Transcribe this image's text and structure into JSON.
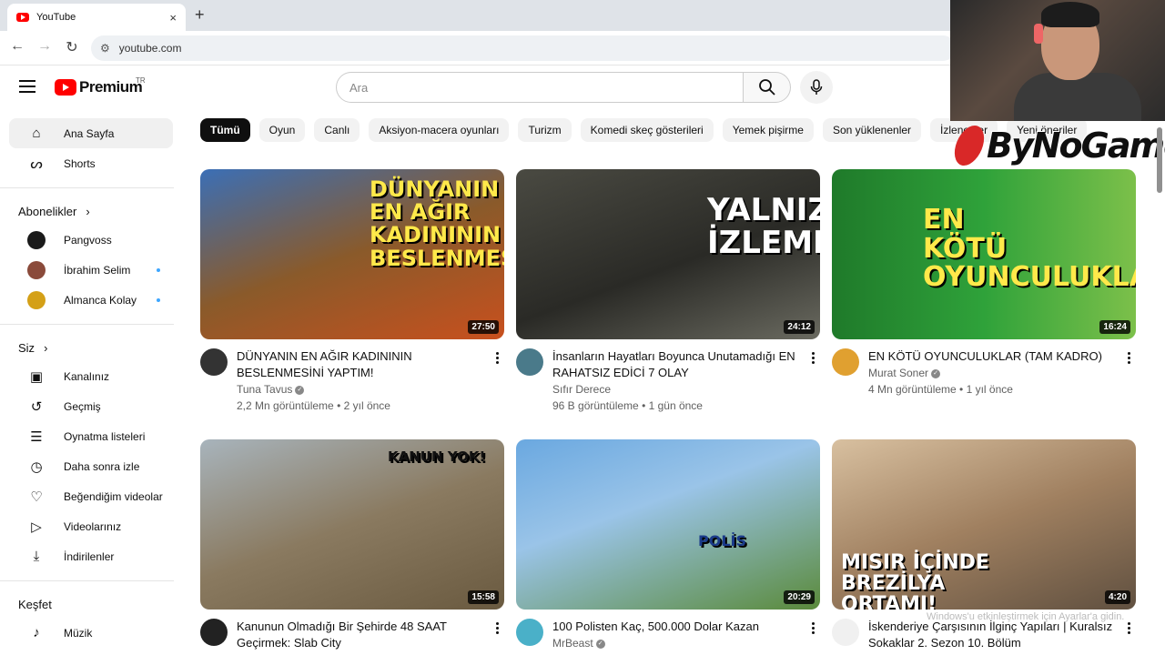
{
  "browser": {
    "tab_title": "YouTube",
    "tab_close": "×",
    "new_tab": "+",
    "url": "youtube.com"
  },
  "header": {
    "logo_text": "Premium",
    "region": "TR",
    "search_placeholder": "Ara"
  },
  "sidebar": {
    "main": [
      {
        "label": "Ana Sayfa",
        "icon": "home-icon"
      },
      {
        "label": "Shorts",
        "icon": "shorts-icon"
      }
    ],
    "subscriptions_title": "Abonelikler",
    "subscriptions": [
      {
        "label": "Pangvoss",
        "color": "#1a1a1a",
        "new": false
      },
      {
        "label": "İbrahim Selim",
        "color": "#8a4a3a",
        "new": true
      },
      {
        "label": "Almanca Kolay",
        "color": "#d4a017",
        "new": true
      }
    ],
    "you_title": "Siz",
    "you": [
      {
        "label": "Kanalınız",
        "icon": "channel-icon"
      },
      {
        "label": "Geçmiş",
        "icon": "history-icon"
      },
      {
        "label": "Oynatma listeleri",
        "icon": "playlists-icon"
      },
      {
        "label": "Daha sonra izle",
        "icon": "watch-later-icon"
      },
      {
        "label": "Beğendiğim videolar",
        "icon": "like-icon"
      },
      {
        "label": "Videolarınız",
        "icon": "your-videos-icon"
      },
      {
        "label": "İndirilenler",
        "icon": "download-icon"
      }
    ],
    "explore_title": "Keşfet",
    "explore": [
      {
        "label": "Müzik",
        "icon": "music-icon"
      }
    ]
  },
  "chips": [
    "Tümü",
    "Oyun",
    "Canlı",
    "Aksiyon-macera oyunları",
    "Turizm",
    "Komedi skeç gösterileri",
    "Yemek pişirme",
    "Son yüklenenler",
    "İzlenenler",
    "Yeni öneriler"
  ],
  "videos": [
    {
      "title": "DÜNYANIN EN AĞIR KADINININ BESLENMESİNİ YAPTIM!",
      "channel": "Tuna Tavus",
      "verified": true,
      "stats": "2,2 Mn görüntüleme • 2 yıl önce",
      "duration": "27:50",
      "thumb_text": "DÜNYANIN EN AĞIR KADINININ BESLENMESİ",
      "thumb_bg": "linear-gradient(160deg,#3b6fb6 0%,#8a5a2a 50%,#c8501e 100%)",
      "avatar_color": "#333"
    },
    {
      "title": "İnsanların Hayatları Boyunca Unutamadığı EN RAHATSIZ EDİCİ 7 OLAY",
      "channel": "Sıfır Derece",
      "verified": false,
      "stats": "96 B görüntüleme • 1 gün önce",
      "duration": "24:12",
      "thumb_text": "YALNIZ İZLEME",
      "thumb_bg": "linear-gradient(160deg,#4a4a42 0%,#2a2a26 55%,#6a6a60 100%)",
      "avatar_color": "#4a7a8a"
    },
    {
      "title": "EN KÖTÜ OYUNCULUKLAR (TAM KADRO)",
      "channel": "Murat Soner",
      "verified": true,
      "stats": "4 Mn görüntüleme • 1 yıl önce",
      "duration": "16:24",
      "thumb_text": "EN KÖTÜ OYUNCULUKLAR",
      "thumb_bg": "linear-gradient(90deg,#1f7a2a 0%,#2fa23a 50%,#7cc04a 100%)",
      "avatar_color": "#e0a030"
    },
    {
      "title": "Kanunun Olmadığı Bir Şehirde 48 SAAT Geçirmek: Slab City",
      "channel": "",
      "verified": false,
      "stats": "",
      "duration": "15:58",
      "thumb_text": "KANUN YOK!",
      "thumb_bg": "linear-gradient(160deg,#a8b4bc 0%,#8a7a60 50%,#6a5a40 100%)",
      "avatar_color": "#222"
    },
    {
      "title": "100 Polisten Kaç, 500.000 Dolar Kazan",
      "channel": "MrBeast",
      "verified": true,
      "stats": "",
      "duration": "20:29",
      "thumb_text": "POLİS",
      "thumb_bg": "linear-gradient(160deg,#6aa8e0 0%,#9ac4e8 40%,#5a8a3a 100%)",
      "avatar_color": "#4ab0c8"
    },
    {
      "title": "İskenderiye Çarşısının İlginç Yapıları | Kuralsız Sokaklar 2. Sezon 10. Bölüm",
      "channel": "",
      "verified": false,
      "stats": "",
      "duration": "4:20",
      "thumb_text": "MISIR İÇİNDE BREZİLYA ORTAMI!",
      "thumb_bg": "linear-gradient(160deg,#d8c0a0 0%,#a08060 50%,#605040 100%)",
      "avatar_color": "#f0f0f0"
    }
  ],
  "overlay": {
    "brand": "ByNoGame",
    "watermark_line1": "Windows'u etkinleştirmek için Ayarlar'a gidin.",
    "watermark_line2": ""
  },
  "colors": {
    "accent": "#ff0000",
    "chip_active": "#0f0f0f"
  }
}
